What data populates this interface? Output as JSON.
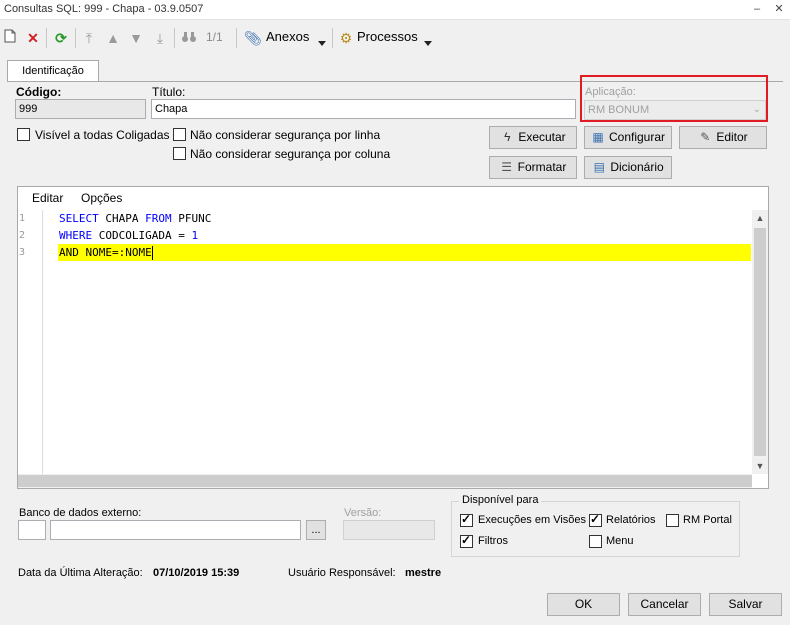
{
  "window": {
    "title": "Consultas SQL: 999 - Chapa - 03.9.0507",
    "minimize": "–",
    "close": "✕"
  },
  "toolbar": {
    "record_counter": "1/1",
    "attachments_label": "Anexos",
    "processes_label": "Processos"
  },
  "tabs": [
    {
      "label": "Identificação"
    }
  ],
  "form": {
    "code_label": "Código:",
    "code_value": "999",
    "title_label": "Título:",
    "title_value": "Chapa",
    "application_label": "Aplicação:",
    "application_value": "RM BONUM",
    "visible_all_label": "Visível a todas Coligadas",
    "ignore_row_security_label": "Não considerar segurança por linha",
    "ignore_col_security_label": "Não considerar segurança por coluna"
  },
  "buttons": {
    "execute": "Executar",
    "configure": "Configurar",
    "editor": "Editor",
    "format": "Formatar",
    "dictionary": "Dicionário"
  },
  "editor": {
    "menu_edit": "Editar",
    "menu_options": "Opções",
    "line_numbers": [
      "1",
      "2",
      "3"
    ],
    "lines": [
      {
        "kw1": "SELECT",
        "t1": " CHAPA ",
        "kw2": "FROM",
        "t2": " PFUNC"
      },
      {
        "kw1": "WHERE",
        "t1": " CODCOLIGADA = ",
        "num": "1"
      },
      {
        "text": "AND NOME=:NOME"
      }
    ]
  },
  "external_db": {
    "label": "Banco de dados externo:",
    "code_value": "",
    "name_value": "",
    "browse_label": "...",
    "version_label": "Versão:",
    "version_value": ""
  },
  "available_for": {
    "legend": "Disponível para",
    "options": [
      {
        "label": "Execuções em Visões",
        "checked": true
      },
      {
        "label": "Relatórios",
        "checked": true
      },
      {
        "label": "RM Portal",
        "checked": false
      },
      {
        "label": "Filtros",
        "checked": true
      },
      {
        "label": "Menu",
        "checked": false
      }
    ]
  },
  "footer": {
    "last_change_label": "Data da Última Alteração:",
    "last_change_value": "07/10/2019 15:39",
    "responsible_label": "Usuário Responsável:",
    "responsible_value": "mestre"
  },
  "dialog_buttons": {
    "ok": "OK",
    "cancel": "Cancelar",
    "save": "Salvar"
  },
  "colors": {
    "highlight": "#ffff00",
    "keyword": "#0000ff",
    "annotation_box": "#e01b24"
  }
}
